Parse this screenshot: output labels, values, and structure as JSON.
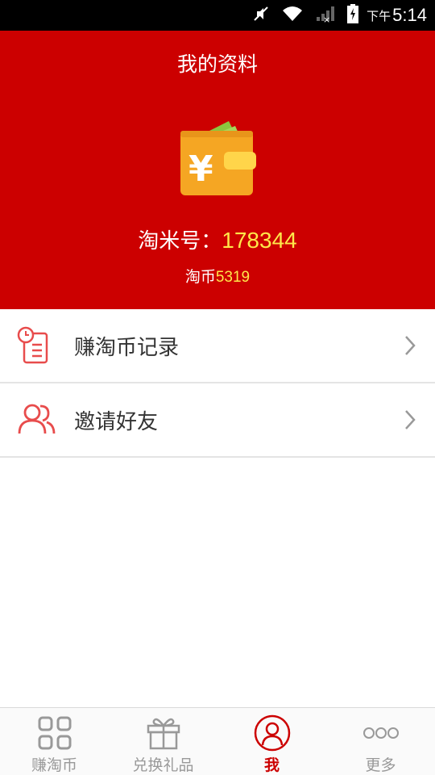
{
  "status_bar": {
    "ampm": "下午",
    "time": "5:14"
  },
  "header": {
    "title": "我的资料",
    "id_label": "淘米号：",
    "id_value": "178344",
    "coin_label": "淘币",
    "coin_value": "5319"
  },
  "menu": {
    "items": [
      {
        "label": "赚淘币记录",
        "icon": "clipboard-clock-icon"
      },
      {
        "label": "邀请好友",
        "icon": "users-icon"
      }
    ]
  },
  "tabbar": {
    "tabs": [
      {
        "label": "赚淘币",
        "icon": "grid-icon",
        "active": false
      },
      {
        "label": "兑换礼品",
        "icon": "gift-icon",
        "active": false
      },
      {
        "label": "我",
        "icon": "person-icon",
        "active": true
      },
      {
        "label": "更多",
        "icon": "more-dots-icon",
        "active": false
      }
    ]
  },
  "colors": {
    "brand_red": "#cc0000",
    "highlight_yellow": "#ffe74a",
    "icon_red": "#e84c4c"
  }
}
